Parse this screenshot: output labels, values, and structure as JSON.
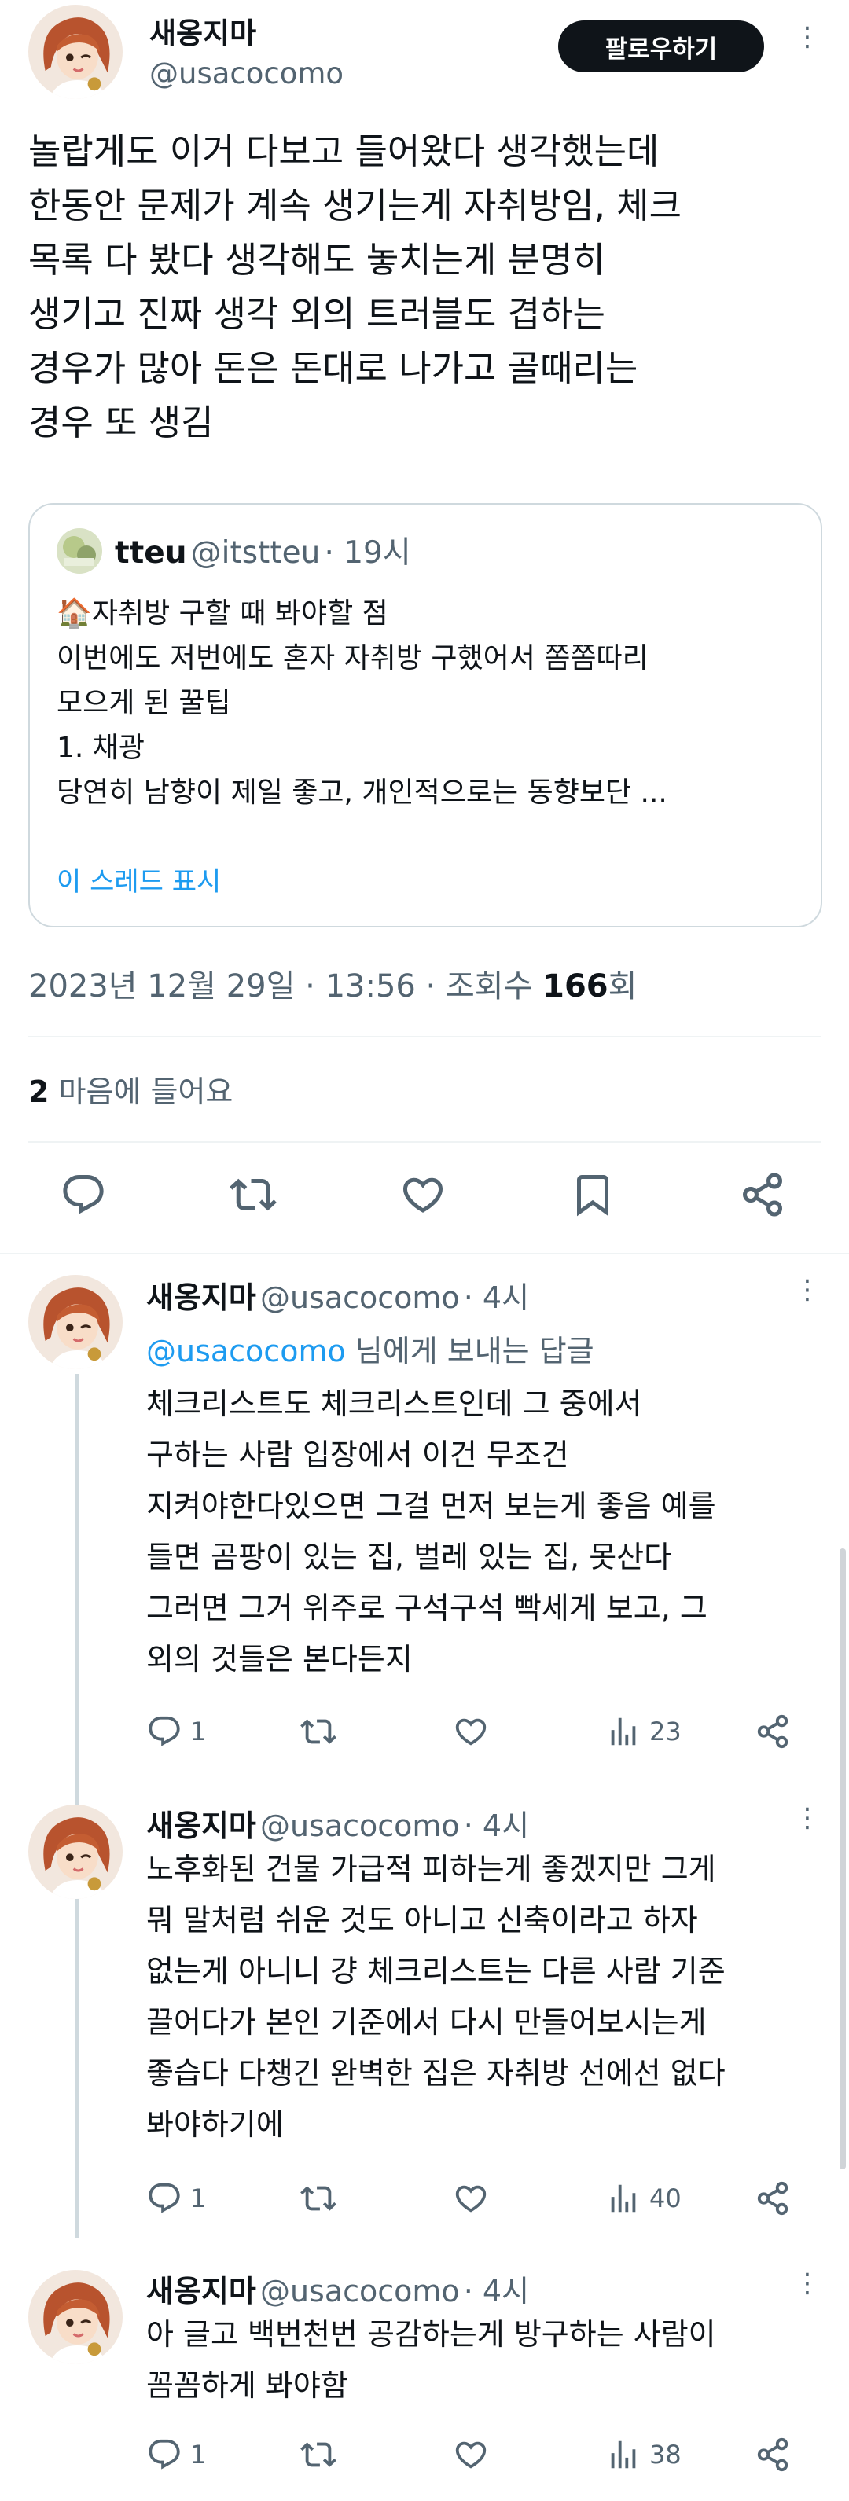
{
  "main_tweet": {
    "name": "새옹지마",
    "handle": "@usacocomo",
    "follow_label": "팔로우하기",
    "text": "놀랍게도 이거 다보고 들어왔다 생각했는데\n한동안 문제가 계속 생기는게 자취방임, 체크\n목록 다 봤다 생각해도 놓치는게 분명히\n생기고 진짜 생각 외의 트러블도 겹하는\n경우가 많아 돈은 돈대로 나가고 골때리는\n경우 또 생김",
    "quote": {
      "name": "tteu",
      "handle": "@itstteu",
      "time": "· 19시",
      "emoji": "🏠",
      "line1": "자취방 구할 때 봐야할 점",
      "line2": "이번에도 저번에도 혼자 자취방 구했어서 쫌쫌따리",
      "line3": "모으게 된 꿀팁",
      "line4": "1. 채광",
      "line5": "당연히 남향이 제일 좋고, 개인적으로는 동향보단 ...",
      "show_thread": "이 스레드 표시"
    },
    "date": "2023년 12월 29일 · 13:56 · 조회수 ",
    "views": "166",
    "views_suffix": "회",
    "likes_count": "2",
    "likes_label": " 마음에 들어요"
  },
  "replies": [
    {
      "name": "새옹지마",
      "handle": "@usacocomo",
      "time": "· 4시",
      "reply_to_mention": "@usacocomo",
      "reply_to_suffix": " 님에게 보내는 답글",
      "text": "체크리스트도 체크리스트인데 그 중에서\n구하는 사람 입장에서 이건 무조건\n지켜야한다있으면 그걸 먼저 보는게 좋음 예를\n들면 곰팡이 있는 집, 벌레 있는 집, 못산다\n그러면 그거 위주로 구석구석 빡세게 보고, 그\n외의 것들은 본다든지",
      "replies": "1",
      "views": "23"
    },
    {
      "name": "새옹지마",
      "handle": "@usacocomo",
      "time": "· 4시",
      "text": "노후화된 건물 가급적 피하는게 좋겠지만 그게\n뭐 말처럼 쉬운 것도 아니고 신축이라고 하자\n없는게 아니니 걍 체크리스트는 다른 사람 기준\n끌어다가 본인 기준에서 다시 만들어보시는게\n좋습다 다챙긴 완벽한 집은 자취방 선에선 없다\n봐야하기에",
      "replies": "1",
      "views": "40"
    },
    {
      "name": "새옹지마",
      "handle": "@usacocomo",
      "time": "· 4시",
      "text": "아 글고 백번천번 공감하는게 방구하는 사람이\n꼼꼼하게 봐야함",
      "replies": "1",
      "views": "38"
    }
  ],
  "colors": {
    "accent": "#1d9bf0",
    "secondary_text": "#536471",
    "border": "#cfd9de"
  },
  "icons": [
    "reply-icon",
    "retweet-icon",
    "like-icon",
    "bookmark-icon",
    "share-icon",
    "views-icon",
    "more-icon"
  ]
}
